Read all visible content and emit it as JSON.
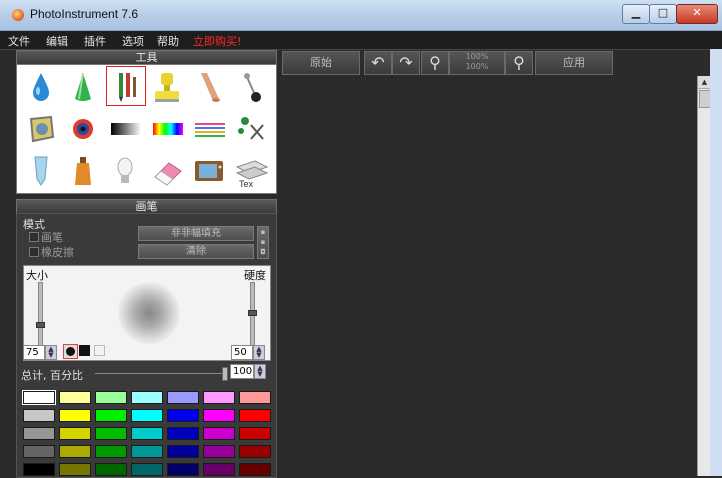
{
  "window": {
    "title": "PhotoInstrument 7.6",
    "buttons": {
      "minimize": "▁",
      "maximize": "□",
      "close": "✕"
    }
  },
  "menu": {
    "items": [
      "文件",
      "编辑",
      "插件",
      "选项",
      "帮助"
    ],
    "promo": "立即购买!"
  },
  "tools": {
    "header": "工具",
    "icons": [
      "water-drop-icon",
      "cone-icon",
      "brush-pencil-icon",
      "stamp-icon",
      "finger-smudge-icon",
      "pin-icon",
      "glass-icon",
      "eye-icon",
      "gradient-bw-icon",
      "spectrum-icon",
      "color-lines-icon",
      "scissors-icon",
      "tube-icon",
      "bottle-icon",
      "bulb-icon",
      "eraser-icon",
      "tv-icon",
      "text-layers-icon"
    ],
    "selected_index": 2
  },
  "brush": {
    "header": "画笔",
    "mode_label": "模式",
    "option_brush": "画笔",
    "option_eraser": "橡皮擦",
    "fill_button": "非非幅填充",
    "clear_button": "清除",
    "size_label": "大小",
    "hardness_label": "硬度",
    "size_value": "75",
    "hardness_value": "50",
    "total_label": "总计, 百分比",
    "total_value": "100"
  },
  "swatch_colors": [
    [
      "#ffffff",
      "#ffff99",
      "#99ff99",
      "#99ffff",
      "#9999ff",
      "#ff99ff",
      "#ff9999"
    ],
    [
      "#c8c8c8",
      "#ffff00",
      "#00ee00",
      "#00ffff",
      "#0000ee",
      "#ff00ff",
      "#ff0000"
    ],
    [
      "#969696",
      "#d4d400",
      "#00bb00",
      "#00cccc",
      "#0000bb",
      "#cc00cc",
      "#cc0000"
    ],
    [
      "#646464",
      "#aaaa00",
      "#009900",
      "#009999",
      "#000099",
      "#990099",
      "#990000"
    ],
    [
      "#000000",
      "#777700",
      "#006600",
      "#006666",
      "#000066",
      "#660066",
      "#660000"
    ]
  ],
  "toolbar": {
    "original_button": "原始",
    "zoom_label_top": "100%",
    "zoom_label_bottom": "100%",
    "apply_button": "应用"
  }
}
